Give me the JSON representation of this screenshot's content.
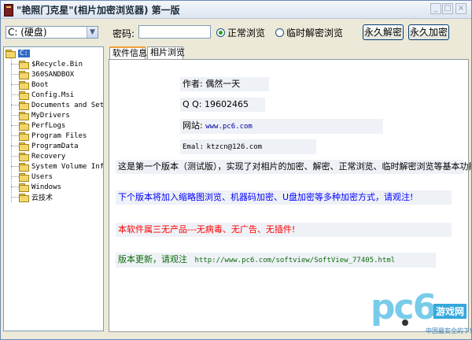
{
  "window": {
    "title": "\"艳照门克星\"(相片加密浏览器) 第一版"
  },
  "toolbar": {
    "drive": "C: (硬盘)",
    "password_label": "密码:",
    "password_value": "",
    "radio_normal": "正常浏览",
    "radio_temp": "临时解密浏览",
    "btn_decrypt": "永久解密",
    "btn_encrypt": "永久加密"
  },
  "tree": {
    "root": "C:",
    "items": [
      "$Recycle.Bin",
      "360SANDBOX",
      "Boot",
      "Config.Msi",
      "Documents and Sett",
      "MyDrivers",
      "PerfLogs",
      "Program Files",
      "ProgramData",
      "Recovery",
      "System Volume Info",
      "Users",
      "Windows",
      "云技术"
    ]
  },
  "tabs": [
    "软件信息",
    "相片浏览"
  ],
  "info": {
    "author": "作者: 偶然一天",
    "qq_label": "Q  Q:",
    "qq": "19602465",
    "site_label": "网站:",
    "site": "www.pc6.com",
    "email_label": "Emal:",
    "email": "ktzcn@126.com",
    "line1": "这是第一个版本（测试版），实现了对相片的加密、解密、正常浏览、临时解密浏览等基本功能!",
    "line2": "下个版本将加入缩略图浏览、机器码加密、U盘加密等多种加密方式，请观注!",
    "line3": "本软件属三无产品---无病毒、无广告、无插件!",
    "update_label": "版本更新，请观注",
    "update_url": "http://www.pc6.com/softview/SoftView_77405.html"
  },
  "watermark": {
    "logo": "pc6",
    "badge": "游戏网",
    "sub": "中国最安全的下载站"
  },
  "colors": {
    "link_blue": "#0000a0",
    "red": "#ff0000",
    "green": "#0c6d0c",
    "selection": "#316ac5"
  }
}
